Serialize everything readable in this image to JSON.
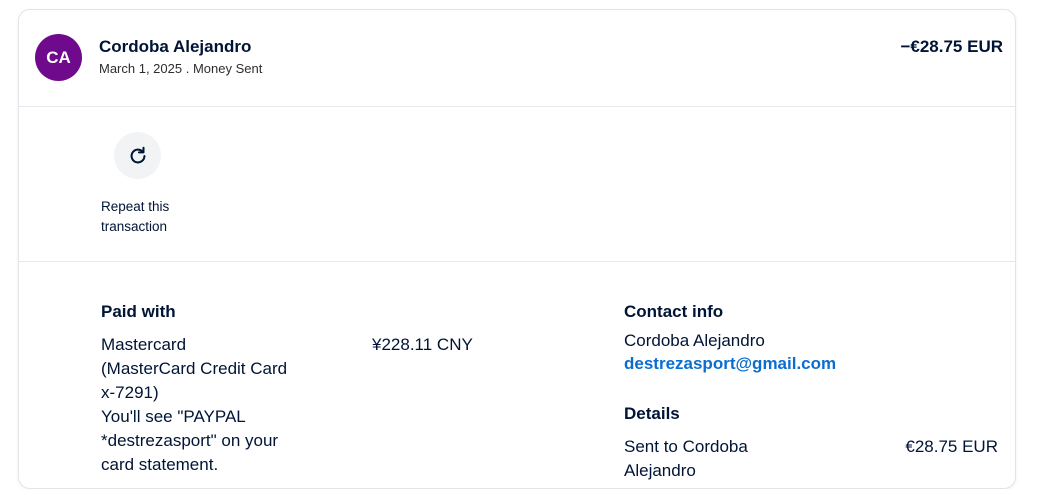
{
  "transaction": {
    "avatar_initials": "CA",
    "avatar_color": "#6f0a8c",
    "name": "Cordoba Alejandro",
    "subline": "March 1, 2025 . Money Sent",
    "amount": "−€28.75 EUR"
  },
  "actions": {
    "repeat_icon": "refresh-icon",
    "repeat_label": "Repeat this transaction"
  },
  "paid_with": {
    "title": "Paid with",
    "method_lines": [
      "Mastercard",
      "(MasterCard Credit Card",
      "x-7291)",
      "You'll see \"PAYPAL",
      "*destrezasport\" on your",
      "card statement."
    ],
    "amount": "¥228.11 CNY"
  },
  "contact_info": {
    "title": "Contact info",
    "name": "Cordoba Alejandro",
    "email": "destrezasport@gmail.com",
    "link_color": "#0a6ed1"
  },
  "details": {
    "title": "Details",
    "sent_to_lines": [
      "Sent to Cordoba",
      "Alejandro"
    ],
    "amount": "€28.75 EUR"
  }
}
